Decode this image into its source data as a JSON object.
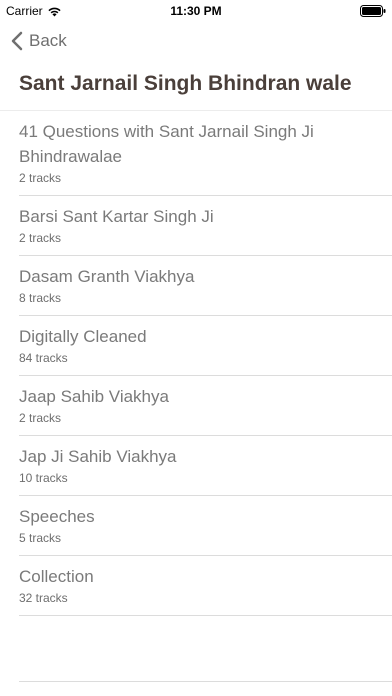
{
  "status_bar": {
    "carrier": "Carrier",
    "time": "11:30 PM",
    "wifi_icon": "wifi-icon",
    "battery_icon": "battery-icon"
  },
  "nav": {
    "back_label": "Back",
    "back_icon": "chevron-left-icon"
  },
  "page": {
    "title": "Sant Jarnail Singh Bhindran wale"
  },
  "albums": [
    {
      "title": "41 Questions with Sant Jarnail Singh Ji Bhindrawalae",
      "tracks": "2 tracks"
    },
    {
      "title": "Barsi Sant Kartar Singh Ji",
      "tracks": "2 tracks"
    },
    {
      "title": "Dasam Granth Viakhya",
      "tracks": "8 tracks"
    },
    {
      "title": "Digitally Cleaned",
      "tracks": "84 tracks"
    },
    {
      "title": "Jaap Sahib Viakhya",
      "tracks": "2 tracks"
    },
    {
      "title": "Jap Ji Sahib Viakhya",
      "tracks": "10 tracks"
    },
    {
      "title": "Speeches",
      "tracks": "5 tracks"
    },
    {
      "title": "Collection",
      "tracks": "32 tracks"
    }
  ],
  "colors": {
    "title": "#4a3f3a",
    "item_text": "#7a7a7a",
    "back_text": "#6f6f6f"
  }
}
